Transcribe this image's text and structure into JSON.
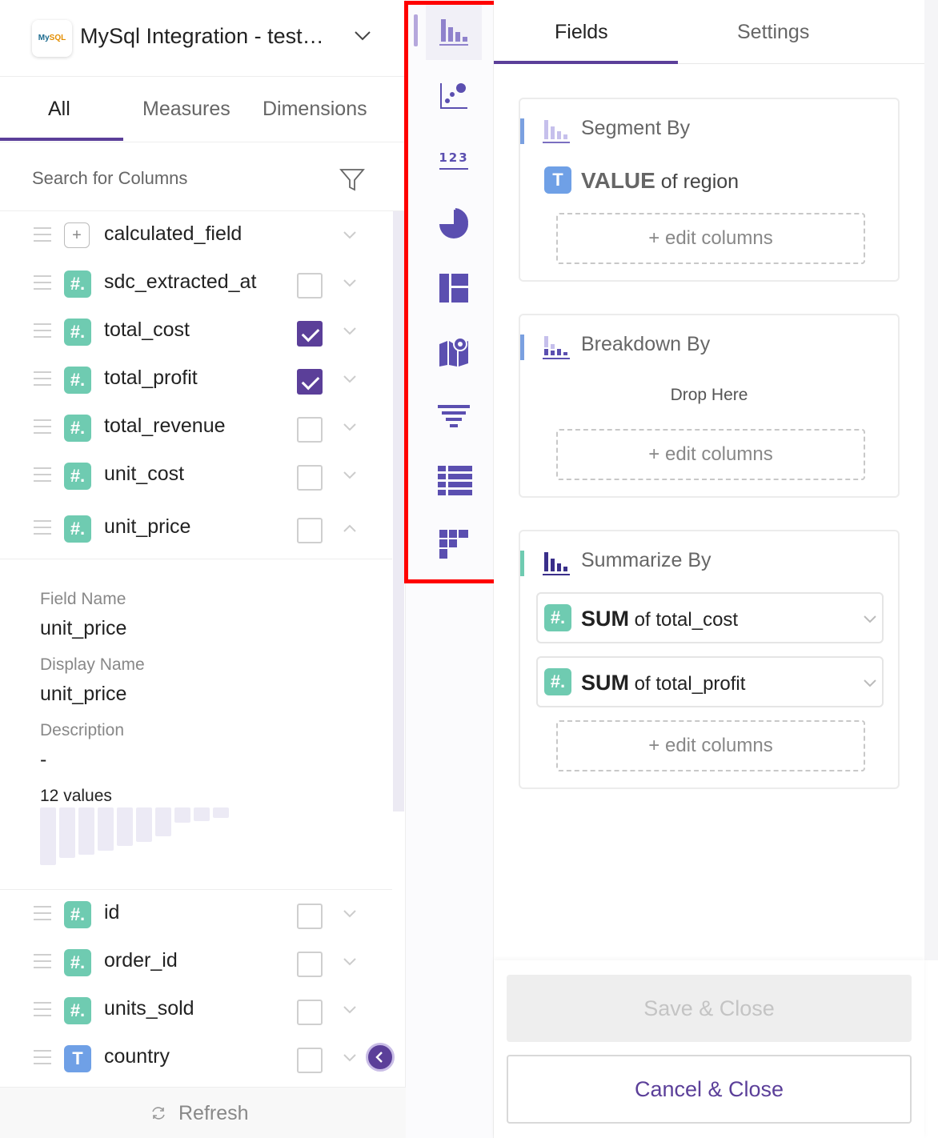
{
  "source": {
    "title": "MySql Integration - test…",
    "logo_text": "MySQL"
  },
  "left_tabs": [
    {
      "label": "All",
      "active": true
    },
    {
      "label": "Measures",
      "active": false
    },
    {
      "label": "Dimensions",
      "active": false
    }
  ],
  "search": {
    "placeholder": "Search for Columns"
  },
  "columns_top": [
    {
      "name": "calculated_field",
      "type": "calc",
      "checked": null,
      "expanded": false
    },
    {
      "name": "sdc_extracted_at",
      "type": "number",
      "checked": false,
      "expanded": false
    },
    {
      "name": "total_cost",
      "type": "number",
      "checked": true,
      "expanded": false
    },
    {
      "name": "total_profit",
      "type": "number",
      "checked": true,
      "expanded": false
    },
    {
      "name": "total_revenue",
      "type": "number",
      "checked": false,
      "expanded": false
    },
    {
      "name": "unit_cost",
      "type": "number",
      "checked": false,
      "expanded": false
    },
    {
      "name": "unit_price",
      "type": "number",
      "checked": false,
      "expanded": true
    }
  ],
  "details": {
    "field_name_label": "Field Name",
    "field_name": "unit_price",
    "display_name_label": "Display Name",
    "display_name": "unit_price",
    "description_label": "Description",
    "description": "-",
    "values_count": "12 values",
    "distribution": [
      1.0,
      0.88,
      0.82,
      0.75,
      0.66,
      0.6,
      0.5,
      0.26,
      0.24,
      0.18
    ]
  },
  "columns_bottom": [
    {
      "name": "id",
      "type": "number",
      "checked": false
    },
    {
      "name": "order_id",
      "type": "number",
      "checked": false
    },
    {
      "name": "units_sold",
      "type": "number",
      "checked": false
    },
    {
      "name": "country",
      "type": "text",
      "checked": false
    }
  ],
  "refresh_label": "Refresh",
  "chart_types": [
    {
      "name": "bar-chart-icon",
      "active": true
    },
    {
      "name": "scatter-chart-icon",
      "active": false
    },
    {
      "name": "number-kpi-icon",
      "active": false,
      "glyph": "123"
    },
    {
      "name": "pie-chart-icon",
      "active": false
    },
    {
      "name": "layout-grid-icon",
      "active": false
    },
    {
      "name": "map-chart-icon",
      "active": false
    },
    {
      "name": "funnel-chart-icon",
      "active": false
    },
    {
      "name": "table-chart-icon",
      "active": false
    },
    {
      "name": "pivot-table-icon",
      "active": false
    }
  ],
  "right_tabs": [
    {
      "label": "Fields",
      "active": true
    },
    {
      "label": "Settings",
      "active": false
    }
  ],
  "segment": {
    "title": "Segment By",
    "value_agg": "VALUE",
    "value_rest": " of region",
    "edit": "+ edit columns"
  },
  "breakdown": {
    "title": "Breakdown By",
    "drop": "Drop Here",
    "edit": "+ edit columns"
  },
  "summarize": {
    "title": "Summarize By",
    "items": [
      {
        "agg": "SUM",
        "rest": " of total_cost"
      },
      {
        "agg": "SUM",
        "rest": " of total_profit"
      }
    ],
    "edit": "+ edit columns"
  },
  "footer": {
    "save": "Save & Close",
    "cancel": "Cancel & Close"
  },
  "colors": {
    "accent": "#5b3f99",
    "number": "#6fcbb1",
    "text": "#6fa0e6",
    "highlight": "#ff0000"
  }
}
